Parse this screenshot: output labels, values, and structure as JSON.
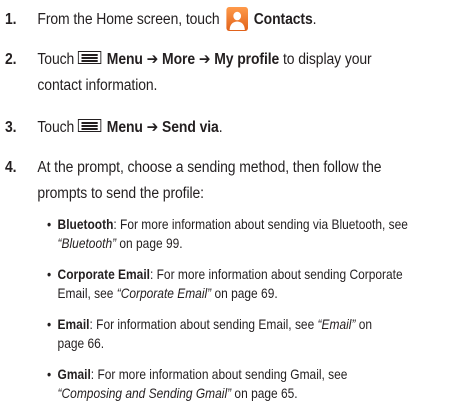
{
  "steps": [
    {
      "number": "1.",
      "text_before": "From the Home screen, touch",
      "icon": "contacts-app-icon",
      "bold": "Contacts",
      "text_after": "."
    },
    {
      "number": "2.",
      "text_before": "Touch",
      "icon": "menu-key-icon",
      "menu": "Menu",
      "arrow1": "➔",
      "more": "More",
      "arrow2": "➔",
      "my_profile": "My profile",
      "text_after": "to display your",
      "line2": "contact information."
    },
    {
      "number": "3.",
      "text_before": "Touch",
      "icon": "menu-key-icon",
      "menu": "Menu",
      "arrow": "➔",
      "send_via": "Send via",
      "text_after": "."
    },
    {
      "number": "4.",
      "line1": "At the prompt, choose a sending method, then follow the",
      "line2": "prompts to send the profile:"
    }
  ],
  "bullets": [
    {
      "dot": "•",
      "term": "Bluetooth",
      "text": ": For more information about sending via Bluetooth, see",
      "xref": "“Bluetooth”",
      "page_text": " on page 99."
    },
    {
      "dot": "•",
      "term": "Corporate Email",
      "text": ": For more information about sending Corporate",
      "text2": "Email, see ",
      "xref": "“Corporate Email”",
      "page_text": " on page 69."
    },
    {
      "dot": "•",
      "term": "Email",
      "text": ": For information about sending Email, see ",
      "xref": "“Email”",
      "page_text": " on",
      "page_text2": "page 66."
    },
    {
      "dot": "•",
      "term": "Gmail",
      "text": ": For more information about sending Gmail, see",
      "xref": "“Composing and Sending Gmail”",
      "page_text": " on page 65."
    }
  ],
  "colors": {
    "text": "#231f20",
    "contacts_icon": "#e8711f"
  }
}
